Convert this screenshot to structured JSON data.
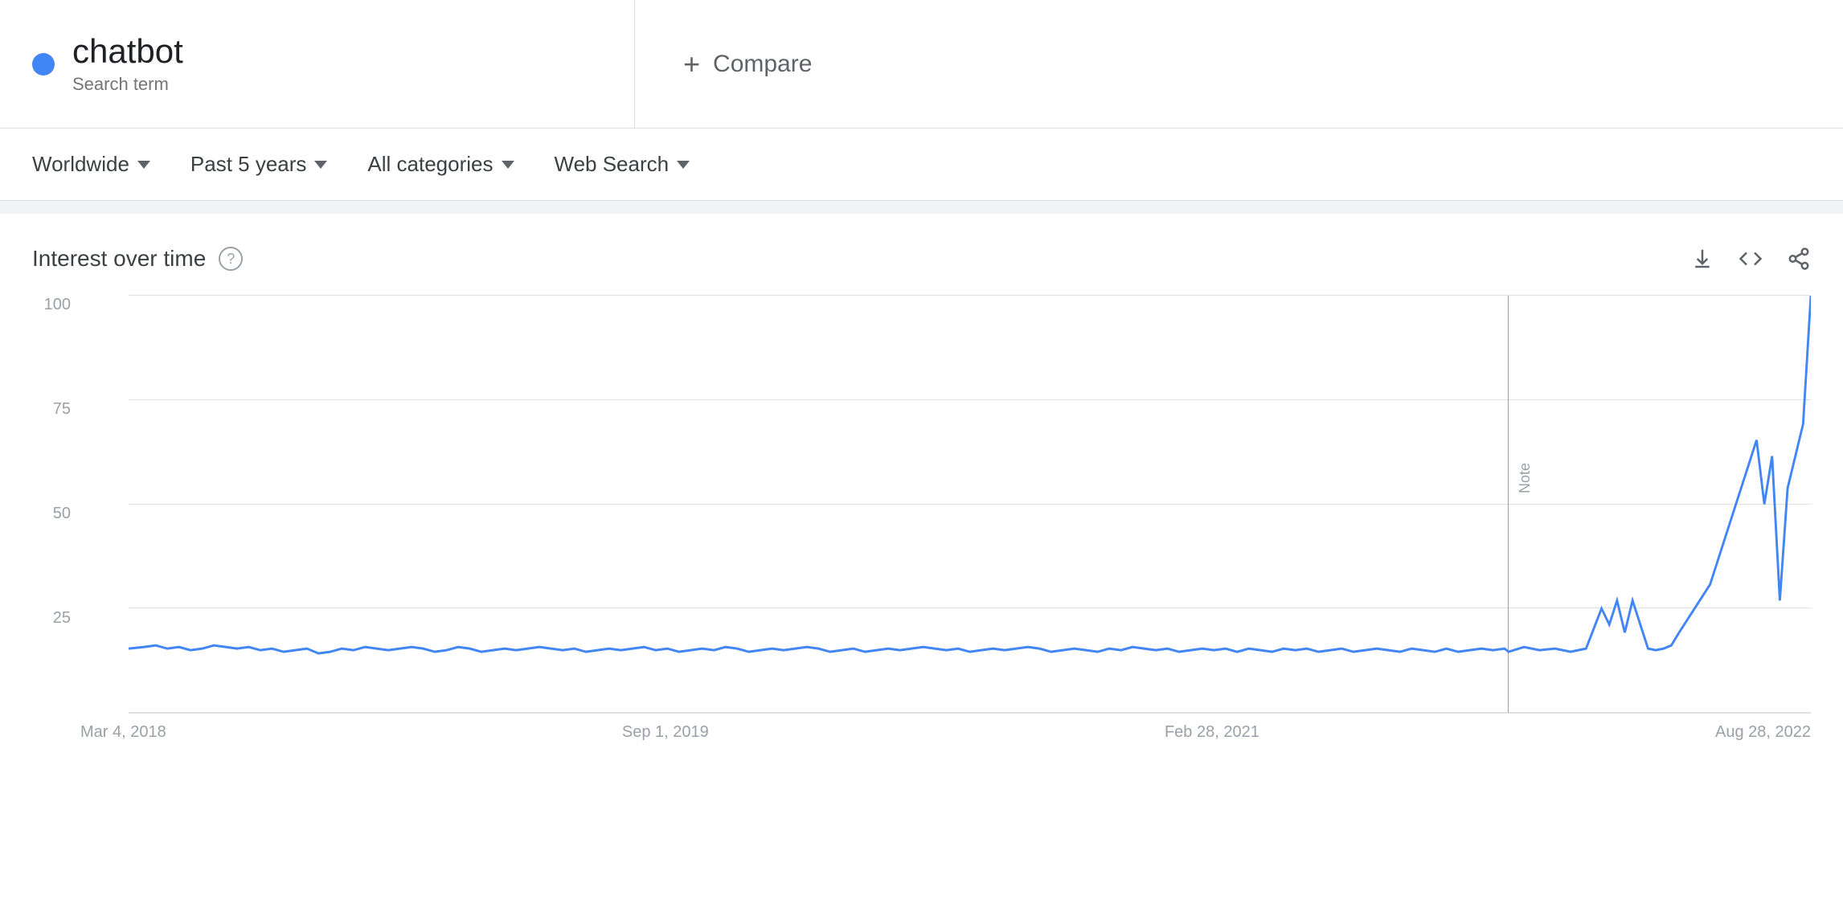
{
  "header": {
    "dot_color": "#4285f4",
    "term": "chatbot",
    "term_type": "Search term",
    "compare_label": "Compare",
    "compare_plus": "+"
  },
  "filters": {
    "location": "Worldwide",
    "time_range": "Past 5 years",
    "category": "All categories",
    "search_type": "Web Search"
  },
  "chart": {
    "title": "Interest over time",
    "help_label": "?",
    "y_labels": [
      "",
      "25",
      "50",
      "75",
      "100"
    ],
    "x_labels": [
      "Mar 4, 2018",
      "Sep 1, 2019",
      "Feb 28, 2021",
      "Aug 28, 2022"
    ],
    "note_label": "Note",
    "download_icon": "↓",
    "embed_icon": "<>",
    "share_icon": "share"
  }
}
